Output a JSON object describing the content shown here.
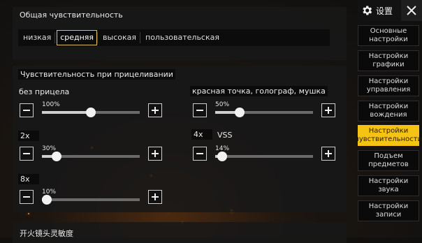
{
  "header": {
    "settings_label": "设置"
  },
  "general": {
    "title": "Общая чувствительность",
    "options": [
      "низкая",
      "средняя",
      "высокая",
      "пользовательская"
    ],
    "selected": "средняя"
  },
  "aim": {
    "title": "Чувствительность при прицеливании",
    "sliders": [
      {
        "label": "без прицела",
        "value": 100,
        "display": "100%"
      },
      {
        "label": "красная точка, голограф, мушка",
        "value": 50,
        "display": "50%"
      },
      {
        "label": "2x",
        "value": 30,
        "display": "30%"
      },
      {
        "label": "4x",
        "value": 14,
        "display": "14%",
        "label_extra": "VSS"
      },
      {
        "label": "8x",
        "value": 10,
        "display": "10%"
      }
    ]
  },
  "fire": {
    "title": "开火镜头灵敏度"
  },
  "nav": [
    {
      "label": "Основные настройки",
      "active": false
    },
    {
      "label": "Настройки графики",
      "active": false
    },
    {
      "label": "Настройки управления",
      "active": false
    },
    {
      "label": "Настройки вождения",
      "active": false
    },
    {
      "label": "Настройки чувствительности",
      "active": true
    },
    {
      "label": "Подъем предметов",
      "active": false
    },
    {
      "label": "Настройки звука",
      "active": false
    },
    {
      "label": "Настройки записи",
      "active": false
    }
  ],
  "icons": {
    "settings": "gear-icon",
    "close": "close-icon"
  }
}
